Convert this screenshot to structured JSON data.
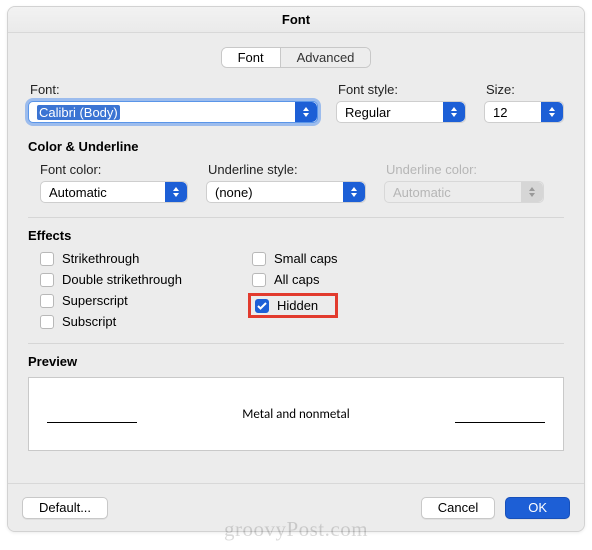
{
  "dialog": {
    "title": "Font"
  },
  "tabs": {
    "font": "Font",
    "advanced": "Advanced",
    "active": "font"
  },
  "font_section": {
    "font_label": "Font:",
    "font_value": "Calibri (Body)",
    "style_label": "Font style:",
    "style_value": "Regular",
    "size_label": "Size:",
    "size_value": "12"
  },
  "color_section": {
    "heading": "Color & Underline",
    "font_color_label": "Font color:",
    "font_color_value": "Automatic",
    "underline_style_label": "Underline style:",
    "underline_style_value": "(none)",
    "underline_color_label": "Underline color:",
    "underline_color_value": "Automatic"
  },
  "effects": {
    "heading": "Effects",
    "strikethrough": "Strikethrough",
    "double_strike": "Double strikethrough",
    "superscript": "Superscript",
    "subscript": "Subscript",
    "small_caps": "Small caps",
    "all_caps": "All caps",
    "hidden": "Hidden",
    "hidden_checked": true
  },
  "preview": {
    "heading": "Preview",
    "text": "Metal and nonmetal"
  },
  "buttons": {
    "default": "Default...",
    "cancel": "Cancel",
    "ok": "OK"
  },
  "watermark": "groovyPost.com"
}
